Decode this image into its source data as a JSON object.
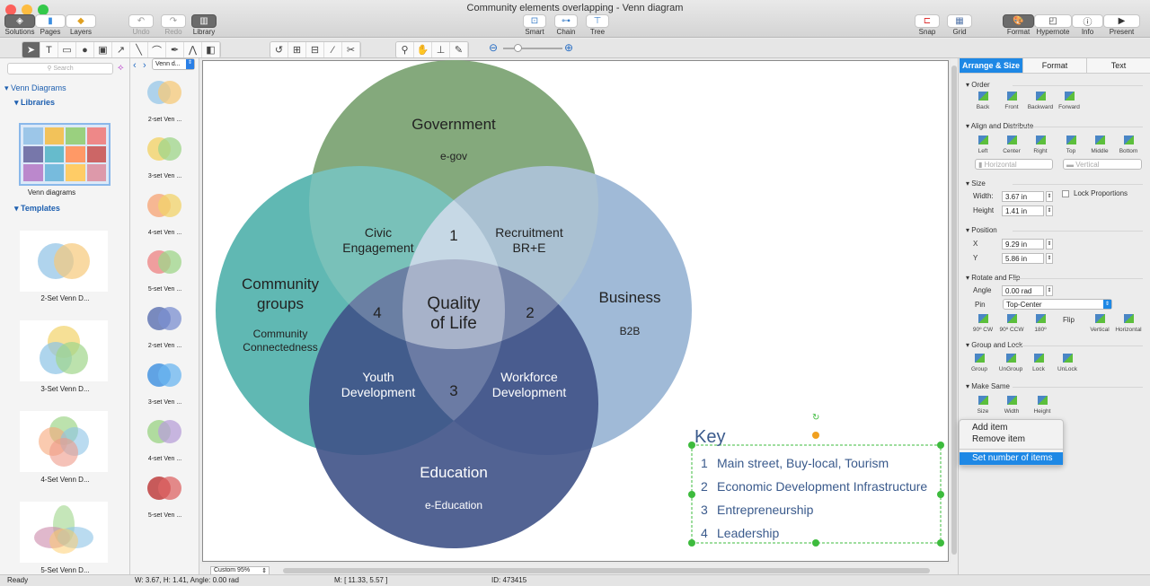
{
  "window": {
    "title": "Community elements overlapping - Venn diagram"
  },
  "toolbar": {
    "solutions": "Solutions",
    "pages": "Pages",
    "layers": "Layers",
    "undo": "Undo",
    "redo": "Redo",
    "library": "Library",
    "smart": "Smart",
    "chain": "Chain",
    "tree": "Tree",
    "snap": "Snap",
    "grid": "Grid",
    "format": "Format",
    "hypernote": "Hypernote",
    "info": "Info",
    "present": "Present"
  },
  "left": {
    "search_placeholder": "Search",
    "tree_root": "Venn Diagrams",
    "libraries": "Libraries",
    "library_item": "Venn diagrams",
    "templates": "Templates",
    "template_items": [
      "2-Set Venn D...",
      "3-Set Venn D...",
      "4-Set Venn D...",
      "5-Set Venn D..."
    ]
  },
  "library_nav": {
    "select": "Venn d...",
    "items": [
      "2-set Ven ...",
      "3-set Ven ...",
      "4-set Ven ...",
      "5-set Ven ...",
      "2-set Ven ...",
      "3-set Ven ...",
      "4-set Ven ...",
      "5-set Ven ..."
    ]
  },
  "diagram": {
    "colors": {
      "government": "#84a97c",
      "community": "#4fb0ab",
      "business": "#8faed0",
      "education": "#3f5287"
    },
    "government": {
      "title": "Government",
      "sub": "e-gov"
    },
    "community": {
      "title_1": "Community",
      "title_2": "groups",
      "sub_1": "Community",
      "sub_2": "Connectedness"
    },
    "business": {
      "title": "Business",
      "sub": "B2B"
    },
    "education": {
      "title": "Education",
      "sub": "e-Education"
    },
    "civic": {
      "l1": "Civic",
      "l2": "Engagement"
    },
    "recruit": {
      "l1": "Recruitment",
      "l2": "BR+E"
    },
    "youth": {
      "l1": "Youth",
      "l2": "Development"
    },
    "workforce": {
      "l1": "Workforce",
      "l2": "Development"
    },
    "center": {
      "l1": "Quality",
      "l2": "of Life"
    },
    "n1": "1",
    "n2": "2",
    "n3": "3",
    "n4": "4",
    "key": {
      "title": "Key",
      "items": [
        {
          "n": "1",
          "t": "Main street, Buy-local, Tourism"
        },
        {
          "n": "2",
          "t": "Economic Development Infrastructure"
        },
        {
          "n": "3",
          "t": "Entrepreneurship"
        },
        {
          "n": "4",
          "t": "Leadership"
        }
      ]
    }
  },
  "right": {
    "tabs": [
      "Arrange & Size",
      "Format",
      "Text"
    ],
    "order": {
      "title": "Order",
      "items": [
        "Back",
        "Front",
        "Backward",
        "Forward"
      ]
    },
    "align": {
      "title": "Align and Distribute",
      "items": [
        "Left",
        "Center",
        "Right",
        "Top",
        "Middle",
        "Bottom"
      ],
      "horizontal": "Horizontal",
      "vertical": "Vertical"
    },
    "size": {
      "title": "Size",
      "width_label": "Width:",
      "width": "3.67 in",
      "height_label": "Height",
      "height": "1.41 in",
      "lock": "Lock Proportions"
    },
    "position": {
      "title": "Position",
      "x_label": "X",
      "x": "9.29 in",
      "y_label": "Y",
      "y": "5.86 in"
    },
    "rotate": {
      "title": "Rotate and Flip",
      "angle_label": "Angle",
      "angle": "0.00 rad",
      "pin_label": "Pin",
      "pin": "Top-Center",
      "items": [
        "90º CW",
        "90º CCW",
        "180º"
      ],
      "flip": "Flip",
      "flip_items": [
        "Vertical",
        "Horizontal"
      ]
    },
    "group": {
      "title": "Group and Lock",
      "items": [
        "Group",
        "UnGroup",
        "Lock",
        "UnLock"
      ]
    },
    "same": {
      "title": "Make Same",
      "items": [
        "Size",
        "Width",
        "Height"
      ]
    }
  },
  "context_menu": {
    "items": [
      "Add item",
      "Remove item",
      "Set number of items"
    ]
  },
  "zoom": "Custom 95%",
  "status": {
    "ready": "Ready",
    "dims": "W: 3.67,  H: 1.41,  Angle: 0.00 rad",
    "mouse": "M: [ 11.33, 5.57 ]",
    "id": "ID: 473415"
  }
}
